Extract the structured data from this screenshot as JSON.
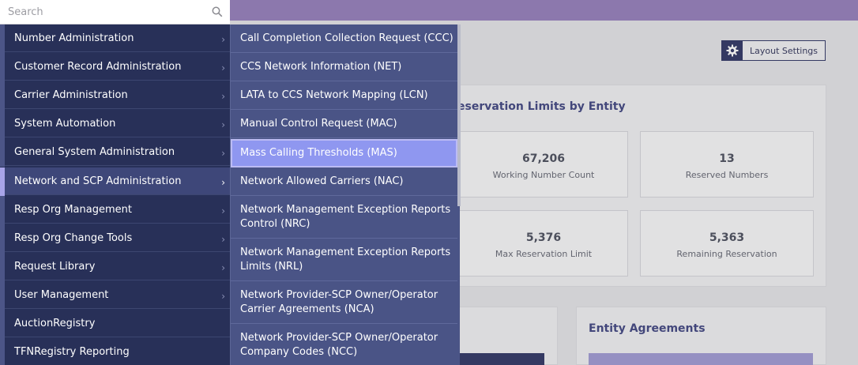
{
  "search": {
    "placeholder": "Search",
    "value": "",
    "icon": "search-icon"
  },
  "menu": {
    "items": [
      {
        "label": "Number Administration",
        "has_submenu": true
      },
      {
        "label": "Customer Record Administration",
        "has_submenu": true
      },
      {
        "label": "Carrier Administration",
        "has_submenu": true
      },
      {
        "label": "System Automation",
        "has_submenu": true
      },
      {
        "label": "General System Administration",
        "has_submenu": true
      },
      {
        "label": "Network and SCP Administration",
        "has_submenu": true,
        "active": true
      },
      {
        "label": "Resp Org Management",
        "has_submenu": true
      },
      {
        "label": "Resp Org Change Tools",
        "has_submenu": true
      },
      {
        "label": "Request Library",
        "has_submenu": true
      },
      {
        "label": "User Management",
        "has_submenu": true
      },
      {
        "label": "AuctionRegistry",
        "has_submenu": false
      },
      {
        "label": "TFNRegistry Reporting",
        "has_submenu": false
      }
    ]
  },
  "submenu": {
    "items": [
      {
        "line1": "Call Completion Collection Request (CCC)",
        "line2": ""
      },
      {
        "line1": "CCS Network Information (NET)",
        "line2": ""
      },
      {
        "line1": "LATA to CCS Network Mapping (LCN)",
        "line2": ""
      },
      {
        "line1": "Manual Control Request (MAC)",
        "line2": ""
      },
      {
        "line1": "Mass Calling Thresholds (MAS)",
        "line2": "",
        "highlighted": true
      },
      {
        "line1": "Network Allowed Carriers (NAC)",
        "line2": ""
      },
      {
        "line1": "Network Management Exception Reports",
        "line2": "Control (NRC)"
      },
      {
        "line1": "Network Management Exception Reports",
        "line2": "Limits (NRL)"
      },
      {
        "line1": "Network Provider-SCP Owner/Operator",
        "line2": "Carrier Agreements (NCA)"
      },
      {
        "line1": "Network Provider-SCP Owner/Operator",
        "line2": "Company Codes (NCC)"
      }
    ]
  },
  "background": {
    "layout_settings_label": "Layout Settings",
    "reservation_card_title": "eservation Limits by Entity",
    "stats": {
      "working_number_count": {
        "value": "67,206",
        "label": "Working Number Count"
      },
      "reserved_numbers": {
        "value": "13",
        "label": "Reserved Numbers"
      },
      "max_reservation_limit": {
        "value": "5,376",
        "label": "Max Reservation Limit"
      },
      "remaining_reservation": {
        "value": "5,363",
        "label": "Remaining Reservation"
      }
    },
    "entity_agreements_title": "Entity Agreements"
  },
  "colors": {
    "menu_bg": "#273059",
    "submenu_bg": "#4a5486",
    "highlight": "#8f97f0",
    "topbar": "#8c78ad",
    "accent_text": "#4a4f88"
  }
}
